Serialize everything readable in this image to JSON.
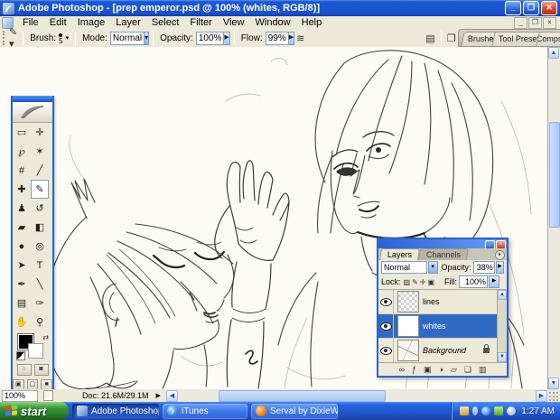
{
  "window": {
    "title": "Adobe Photoshop - [prep emperor.psd @ 100% (whites, RGB/8)]"
  },
  "menus": [
    "File",
    "Edit",
    "Image",
    "Layer",
    "Select",
    "Filter",
    "View",
    "Window",
    "Help"
  ],
  "options": {
    "brush_label": "Brush:",
    "brush_size": "5",
    "mode_label": "Mode:",
    "mode": "Normal",
    "opacity_label": "Opacity:",
    "opacity": "100%",
    "flow_label": "Flow:",
    "flow": "99%",
    "well_tabs": [
      "Brushes",
      "Tool Presets",
      "Layer Comps"
    ]
  },
  "tools": [
    {
      "name": "rectangular-marquee",
      "glyph": "▭"
    },
    {
      "name": "move",
      "glyph": "✛"
    },
    {
      "name": "lasso",
      "glyph": "℘"
    },
    {
      "name": "magic-wand",
      "glyph": "✶"
    },
    {
      "name": "crop",
      "glyph": "#"
    },
    {
      "name": "slice",
      "glyph": "╱"
    },
    {
      "name": "healing-brush",
      "glyph": "✚"
    },
    {
      "name": "brush",
      "glyph": "✎",
      "selected": true
    },
    {
      "name": "clone-stamp",
      "glyph": "♟"
    },
    {
      "name": "history-brush",
      "glyph": "↺"
    },
    {
      "name": "eraser",
      "glyph": "▰"
    },
    {
      "name": "gradient-paint-bucket",
      "glyph": "◧"
    },
    {
      "name": "blur",
      "glyph": "●"
    },
    {
      "name": "dodge",
      "glyph": "◎"
    },
    {
      "name": "path-selection",
      "glyph": "➤"
    },
    {
      "name": "type",
      "glyph": "T"
    },
    {
      "name": "pen",
      "glyph": "✒"
    },
    {
      "name": "line-shape",
      "glyph": "╲"
    },
    {
      "name": "notes",
      "glyph": "▤"
    },
    {
      "name": "eyedropper",
      "glyph": "✑"
    },
    {
      "name": "hand",
      "glyph": "✋"
    },
    {
      "name": "zoom-tool",
      "glyph": "⚲"
    }
  ],
  "layers_panel": {
    "tabs": [
      "Layers",
      "Channels"
    ],
    "mode": "Normal",
    "opacity_label": "Opacity:",
    "opacity": "38%",
    "lock_label": "Lock:",
    "fill_label": "Fill:",
    "fill": "100%",
    "lock_icons": [
      {
        "name": "lock-transparency-icon",
        "glyph": "▨"
      },
      {
        "name": "lock-pixels-icon",
        "glyph": "✎"
      },
      {
        "name": "lock-position-icon",
        "glyph": "✛"
      },
      {
        "name": "lock-all-icon",
        "glyph": "▣"
      }
    ],
    "layers": [
      {
        "name": "lines",
        "thumb": "checker",
        "selected": false,
        "locked": false,
        "italic": false
      },
      {
        "name": "whites",
        "thumb": "white",
        "selected": true,
        "locked": false,
        "italic": false
      },
      {
        "name": "Background",
        "thumb": "sketch",
        "selected": false,
        "locked": true,
        "italic": true
      }
    ],
    "bottom_icons": [
      {
        "name": "link-layers-icon",
        "glyph": "∞"
      },
      {
        "name": "layer-style-icon",
        "glyph": "ƒ"
      },
      {
        "name": "add-layer-mask-icon",
        "glyph": "▣"
      },
      {
        "name": "adjustment-layer-icon",
        "glyph": "◑"
      },
      {
        "name": "new-group-icon",
        "glyph": "▱"
      },
      {
        "name": "new-layer-icon",
        "glyph": "❏"
      },
      {
        "name": "delete-layer-icon",
        "glyph": "▥"
      }
    ]
  },
  "status": {
    "zoom": "100%",
    "doc": "Doc: 21.6M/29.1M"
  },
  "taskbar": {
    "start": "start",
    "tasks": [
      {
        "label": "Adobe Photoshop - [...",
        "icon": "ps",
        "active": true
      },
      {
        "label": "iTunes",
        "icon": "itunes",
        "active": false
      },
      {
        "label": "Serval by DixieWings ...",
        "icon": "firefox",
        "active": false
      }
    ],
    "clock": "1:27 AM"
  },
  "colors": {
    "titlebar": "#1d57d2",
    "taskbar": "#2663e0",
    "selection": "#316ac5",
    "start_green": "#379637"
  }
}
